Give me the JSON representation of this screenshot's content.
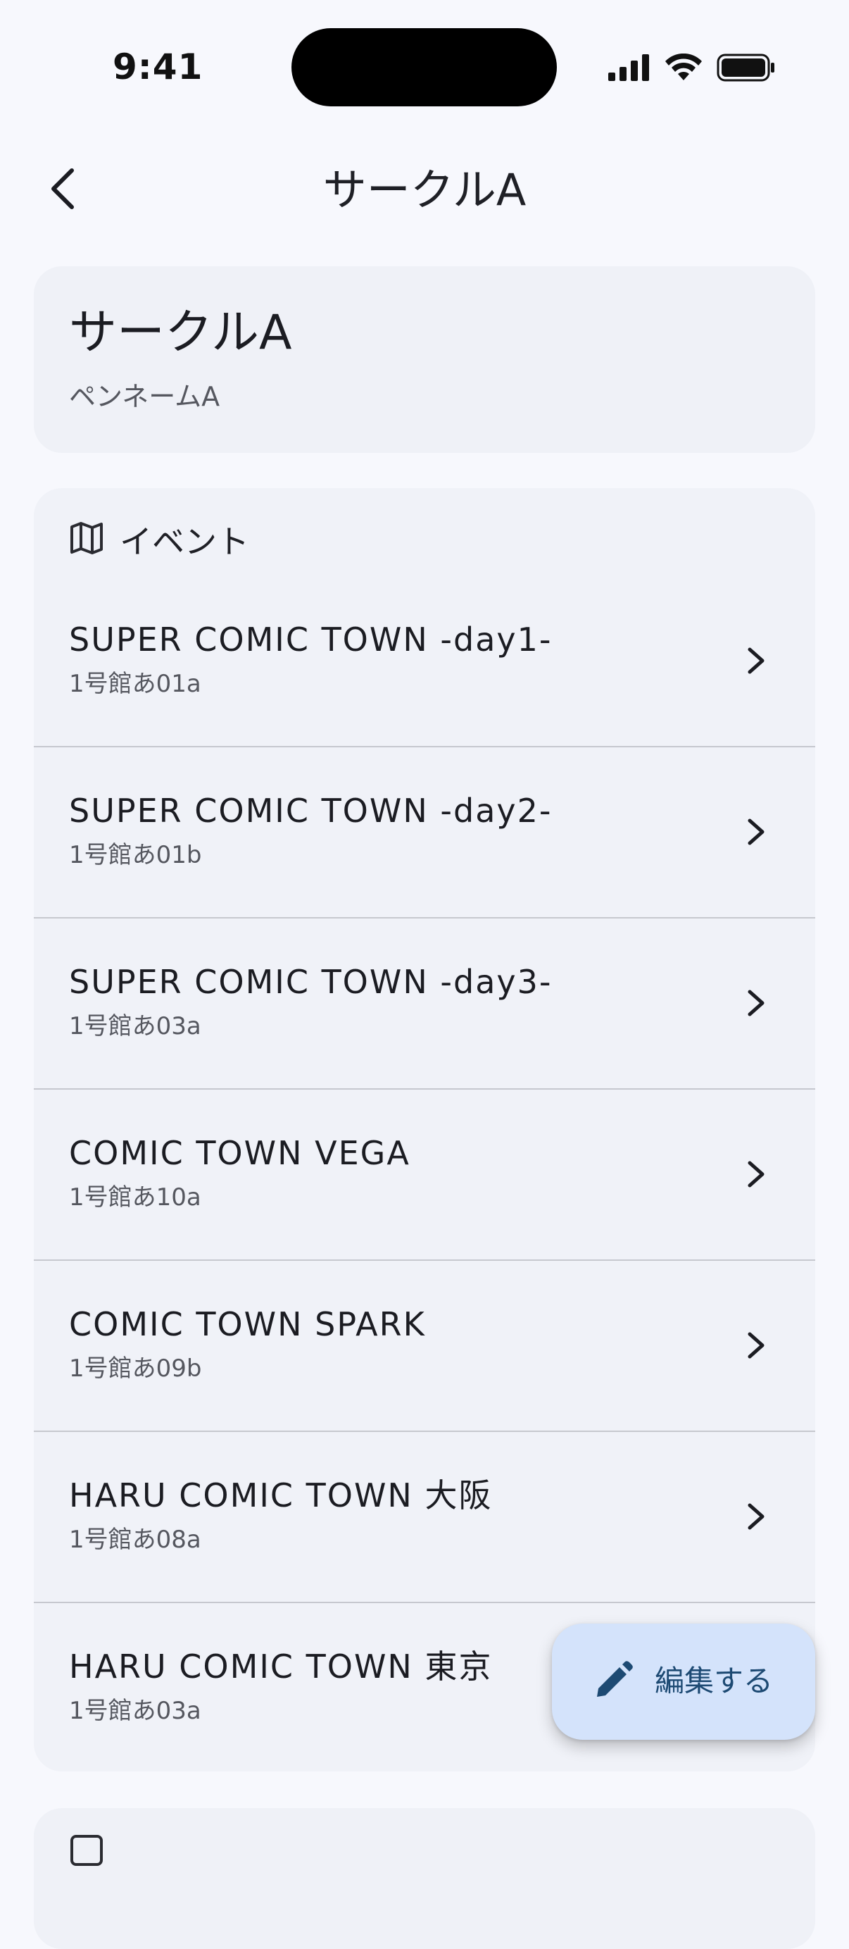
{
  "status_bar": {
    "time": "9:41"
  },
  "app_bar": {
    "title": "サークルA"
  },
  "profile": {
    "circle_name": "サークルA",
    "pen_name": "ペンネームA"
  },
  "events": {
    "header_label": "イベント",
    "items": [
      {
        "name": "SUPER COMIC TOWN -day1-",
        "location": "1号館あ01a"
      },
      {
        "name": "SUPER COMIC TOWN -day2-",
        "location": "1号館あ01b"
      },
      {
        "name": "SUPER COMIC TOWN -day3-",
        "location": "1号館あ03a"
      },
      {
        "name": "COMIC TOWN VEGA",
        "location": "1号館あ10a"
      },
      {
        "name": "COMIC TOWN SPARK",
        "location": "1号館あ09b"
      },
      {
        "name": "HARU COMIC TOWN 大阪",
        "location": "1号館あ08a"
      },
      {
        "name": "HARU COMIC TOWN 東京",
        "location": "1号館あ03a"
      }
    ]
  },
  "fab": {
    "label": "編集する"
  },
  "colors": {
    "background": "#f7f8fd",
    "card": "#eff1f7",
    "fab_background": "#d4e3fb",
    "fab_foreground": "#1d4a73",
    "divider": "#c6c8cf"
  }
}
